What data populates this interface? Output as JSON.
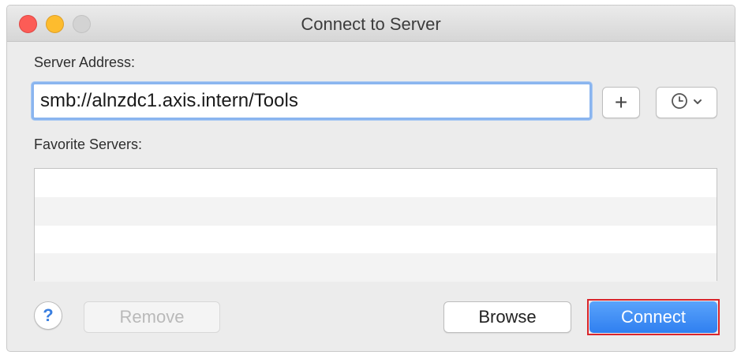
{
  "window": {
    "title": "Connect to Server"
  },
  "server_address": {
    "label": "Server Address:",
    "value": "smb://alnzdc1.axis.intern/Tools"
  },
  "buttons": {
    "add_label": "+",
    "help_label": "?",
    "remove_label": "Remove",
    "browse_label": "Browse",
    "connect_label": "Connect"
  },
  "favorites": {
    "label": "Favorite Servers:",
    "items": []
  },
  "icons": {
    "recent": "clock-icon",
    "dropdown": "chevron-down-icon"
  },
  "colors": {
    "connect_button": "#2f7ff0",
    "highlight_border": "#d9252b",
    "close_light": "#fc5c56",
    "minimize_light": "#fdbc2e",
    "zoom_light": "#d3d3d3"
  }
}
